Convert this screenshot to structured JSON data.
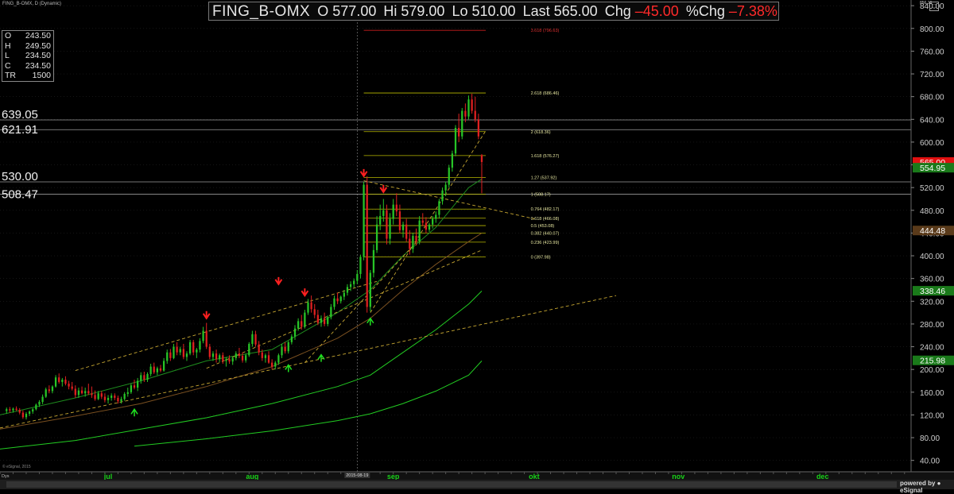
{
  "header": {
    "chart_id": "FING_B-OMX, D (Dynamic)",
    "symbol": "FING_B-OMX",
    "open_label": "O",
    "open": "577.00",
    "high_label": "Hi",
    "high": "579.00",
    "low_label": "Lo",
    "low": "510.00",
    "last_label": "Last",
    "last": "565.00",
    "chg_label": "Chg",
    "chg": "–45.00",
    "pchg_label": "%Chg",
    "pchg": "–7.38%"
  },
  "cursor_box": {
    "rows": [
      {
        "label": "O",
        "value": "243.50"
      },
      {
        "label": "H",
        "value": "249.50"
      },
      {
        "label": "L",
        "value": "234.50"
      },
      {
        "label": "C",
        "value": "234.50"
      },
      {
        "label": "TR",
        "value": "1500"
      }
    ]
  },
  "controls": {
    "corner_button": "□"
  },
  "footer": {
    "copyright": "© eSignal, 2015",
    "powered_by": "powered by ● eSignal",
    "period_label": "Dys"
  },
  "colors": {
    "background": "#000000",
    "up_candle": "#27c427",
    "down_candle": "#e02020",
    "trendline": "#c8a832",
    "fib_line": "#b8b800",
    "fib_top_line": "#c81e1e",
    "hline": "#9a9a9a",
    "ma_fast": "#1e8c1e",
    "ma_mid": "#7a5020",
    "ma_slow": "#22cc22",
    "last_tag": "#e01010",
    "ma_tag": "#1a7a1a"
  },
  "chart_data": {
    "type": "candlestick",
    "ylim": [
      20,
      850
    ],
    "yticks": [
      40,
      80,
      120,
      160,
      200,
      240,
      280,
      320,
      360,
      400,
      440,
      480,
      520,
      560,
      600,
      640,
      680,
      720,
      760,
      800,
      840
    ],
    "yticks_labels": [
      "40.00",
      "80.00",
      "120.00",
      "160.00",
      "200.00",
      "240.00",
      "280.00",
      "320.00",
      "360.00",
      "400.00",
      "440.00",
      "480.00",
      "520.00",
      "560.00",
      "600.00",
      "640.00",
      "680.00",
      "720.00",
      "760.00",
      "800.00",
      "840.00"
    ],
    "top_tick_label": "856.16",
    "x_months": [
      {
        "label": "jul",
        "x": 20
      },
      {
        "label": "aug",
        "x": 64
      },
      {
        "label": "sep",
        "x": 107
      },
      {
        "label": "okt",
        "x": 150
      },
      {
        "label": "nov",
        "x": 194
      },
      {
        "label": "dec",
        "x": 238
      }
    ],
    "x_cursor": {
      "label": "2015-08-19",
      "x": 96
    },
    "xlim": [
      -13,
      265
    ],
    "candles": [
      [
        -11,
        127,
        133,
        122,
        130
      ],
      [
        -10,
        130,
        134,
        124,
        128
      ],
      [
        -9,
        128,
        133,
        124,
        131
      ],
      [
        -8,
        131,
        135,
        127,
        129
      ],
      [
        -7,
        129,
        132,
        121,
        124
      ],
      [
        -6,
        124,
        128,
        113,
        116
      ],
      [
        -5,
        116,
        125,
        112,
        122
      ],
      [
        -4,
        122,
        128,
        118,
        126
      ],
      [
        -3,
        126,
        132,
        122,
        130
      ],
      [
        -2,
        130,
        140,
        128,
        138
      ],
      [
        -1,
        138,
        146,
        134,
        143
      ],
      [
        0,
        143,
        156,
        139,
        152
      ],
      [
        1,
        152,
        168,
        150,
        165
      ],
      [
        2,
        165,
        172,
        158,
        162
      ],
      [
        3,
        162,
        172,
        158,
        170
      ],
      [
        4,
        170,
        190,
        168,
        186
      ],
      [
        5,
        186,
        193,
        175,
        178
      ],
      [
        6,
        178,
        185,
        170,
        182
      ],
      [
        7,
        182,
        188,
        172,
        175
      ],
      [
        8,
        175,
        180,
        165,
        170
      ],
      [
        9,
        170,
        178,
        163,
        166
      ],
      [
        10,
        166,
        172,
        150,
        155
      ],
      [
        11,
        155,
        168,
        150,
        163
      ],
      [
        12,
        163,
        170,
        156,
        158
      ],
      [
        13,
        158,
        168,
        152,
        162
      ],
      [
        14,
        162,
        175,
        155,
        158
      ],
      [
        15,
        158,
        170,
        150,
        155
      ],
      [
        16,
        155,
        163,
        145,
        148
      ],
      [
        17,
        148,
        162,
        146,
        158
      ],
      [
        18,
        158,
        162,
        148,
        152
      ],
      [
        19,
        152,
        158,
        142,
        146
      ],
      [
        20,
        146,
        155,
        140,
        150
      ],
      [
        21,
        150,
        158,
        145,
        154
      ],
      [
        22,
        154,
        158,
        146,
        150
      ],
      [
        23,
        150,
        154,
        140,
        144
      ],
      [
        24,
        144,
        152,
        140,
        148
      ],
      [
        25,
        148,
        160,
        145,
        157
      ],
      [
        26,
        157,
        168,
        152,
        160
      ],
      [
        27,
        160,
        175,
        157,
        172
      ],
      [
        28,
        172,
        182,
        165,
        168
      ],
      [
        29,
        168,
        185,
        162,
        180
      ],
      [
        30,
        180,
        195,
        175,
        190
      ],
      [
        31,
        190,
        196,
        178,
        182
      ],
      [
        32,
        182,
        195,
        178,
        192
      ],
      [
        33,
        192,
        210,
        188,
        205
      ],
      [
        34,
        205,
        212,
        192,
        195
      ],
      [
        35,
        195,
        205,
        190,
        202
      ],
      [
        36,
        202,
        208,
        195,
        198
      ],
      [
        37,
        198,
        220,
        196,
        215
      ],
      [
        38,
        215,
        235,
        210,
        230
      ],
      [
        39,
        230,
        236,
        215,
        220
      ],
      [
        40,
        220,
        245,
        218,
        240
      ],
      [
        41,
        240,
        248,
        225,
        230
      ],
      [
        42,
        230,
        240,
        225,
        236
      ],
      [
        43,
        236,
        245,
        218,
        222
      ],
      [
        44,
        222,
        232,
        215,
        228
      ],
      [
        45,
        228,
        252,
        225,
        248
      ],
      [
        46,
        248,
        252,
        225,
        230
      ],
      [
        47,
        230,
        238,
        220,
        235
      ],
      [
        48,
        235,
        255,
        230,
        250
      ],
      [
        49,
        250,
        275,
        246,
        268
      ],
      [
        50,
        268,
        282,
        236,
        240
      ],
      [
        51,
        240,
        245,
        218,
        222
      ],
      [
        52,
        222,
        232,
        215,
        228
      ],
      [
        53,
        228,
        235,
        212,
        218
      ],
      [
        54,
        218,
        228,
        213,
        225
      ],
      [
        55,
        225,
        230,
        210,
        215
      ],
      [
        56,
        215,
        222,
        205,
        218
      ],
      [
        57,
        218,
        225,
        210,
        214
      ],
      [
        58,
        214,
        222,
        208,
        220
      ],
      [
        59,
        220,
        232,
        216,
        228
      ],
      [
        60,
        228,
        238,
        220,
        224
      ],
      [
        61,
        224,
        230,
        212,
        216
      ],
      [
        62,
        216,
        228,
        212,
        225
      ],
      [
        63,
        225,
        248,
        222,
        245
      ],
      [
        64,
        245,
        268,
        240,
        262
      ],
      [
        65,
        262,
        268,
        240,
        244
      ],
      [
        66,
        244,
        250,
        225,
        230
      ],
      [
        67,
        230,
        235,
        215,
        220
      ],
      [
        68,
        220,
        228,
        212,
        225
      ],
      [
        69,
        225,
        232,
        210,
        212
      ],
      [
        70,
        212,
        218,
        200,
        205
      ],
      [
        71,
        205,
        215,
        200,
        212
      ],
      [
        72,
        212,
        228,
        208,
        225
      ],
      [
        73,
        225,
        245,
        220,
        240
      ],
      [
        74,
        240,
        248,
        228,
        232
      ],
      [
        75,
        232,
        250,
        228,
        248
      ],
      [
        76,
        248,
        262,
        244,
        258
      ],
      [
        77,
        258,
        278,
        252,
        272
      ],
      [
        78,
        272,
        290,
        268,
        285
      ],
      [
        79,
        285,
        296,
        270,
        275
      ],
      [
        80,
        275,
        305,
        272,
        300
      ],
      [
        81,
        300,
        324,
        296,
        318
      ],
      [
        82,
        318,
        330,
        300,
        306
      ],
      [
        83,
        306,
        315,
        290,
        296
      ],
      [
        84,
        296,
        305,
        278,
        282
      ],
      [
        85,
        282,
        295,
        275,
        290
      ],
      [
        86,
        290,
        300,
        276,
        280
      ],
      [
        87,
        280,
        295,
        276,
        292
      ],
      [
        88,
        292,
        315,
        288,
        310
      ],
      [
        89,
        310,
        330,
        305,
        325
      ],
      [
        90,
        325,
        335,
        315,
        320
      ],
      [
        91,
        320,
        330,
        316,
        328
      ],
      [
        92,
        328,
        340,
        322,
        335
      ],
      [
        93,
        335,
        350,
        330,
        345
      ],
      [
        94,
        345,
        355,
        338,
        350
      ],
      [
        95,
        350,
        360,
        344,
        356
      ],
      [
        96,
        356,
        375,
        350,
        368
      ],
      [
        97,
        368,
        402,
        360,
        398
      ],
      [
        98,
        398,
        530,
        392,
        525
      ],
      [
        99,
        525,
        540,
        300,
        310
      ],
      [
        100,
        310,
        375,
        302,
        370
      ],
      [
        101,
        370,
        420,
        362,
        410
      ],
      [
        102,
        410,
        470,
        405,
        455
      ],
      [
        103,
        455,
        490,
        445,
        470
      ],
      [
        104,
        470,
        500,
        460,
        480
      ],
      [
        105,
        480,
        490,
        420,
        430
      ],
      [
        106,
        430,
        475,
        420,
        465
      ],
      [
        107,
        465,
        500,
        455,
        490
      ],
      [
        108,
        490,
        510,
        470,
        478
      ],
      [
        109,
        478,
        490,
        440,
        445
      ],
      [
        110,
        445,
        460,
        432,
        455
      ],
      [
        111,
        455,
        465,
        425,
        430
      ],
      [
        112,
        430,
        445,
        402,
        412
      ],
      [
        113,
        412,
        440,
        405,
        435
      ],
      [
        114,
        435,
        448,
        418,
        425
      ],
      [
        115,
        425,
        470,
        420,
        462
      ],
      [
        116,
        462,
        475,
        452,
        458
      ],
      [
        117,
        458,
        468,
        440,
        446
      ],
      [
        118,
        446,
        458,
        442,
        455
      ],
      [
        119,
        455,
        470,
        448,
        465
      ],
      [
        120,
        465,
        478,
        458,
        472
      ],
      [
        121,
        472,
        500,
        466,
        496
      ],
      [
        122,
        496,
        520,
        490,
        515
      ],
      [
        123,
        515,
        530,
        505,
        525
      ],
      [
        124,
        525,
        560,
        520,
        555
      ],
      [
        125,
        555,
        585,
        548,
        580
      ],
      [
        126,
        580,
        630,
        575,
        625
      ],
      [
        127,
        625,
        650,
        600,
        610
      ],
      [
        128,
        610,
        660,
        605,
        655
      ],
      [
        129,
        655,
        668,
        635,
        645
      ],
      [
        130,
        645,
        682,
        640,
        675
      ],
      [
        131,
        675,
        685,
        650,
        655
      ],
      [
        132,
        655,
        680,
        635,
        640
      ],
      [
        133,
        640,
        650,
        605,
        610
      ],
      [
        134,
        577,
        579,
        510,
        565
      ]
    ],
    "moving_averages": [
      {
        "points": [
          [
            -13,
            120
          ],
          [
            10,
            150
          ],
          [
            30,
            180
          ],
          [
            50,
            215
          ],
          [
            70,
            235
          ],
          [
            90,
            300
          ],
          [
            100,
            340
          ],
          [
            110,
            400
          ],
          [
            120,
            450
          ],
          [
            130,
            520
          ],
          [
            134,
            535
          ]
        ]
      },
      {
        "points": [
          [
            -13,
            95
          ],
          [
            10,
            118
          ],
          [
            30,
            140
          ],
          [
            50,
            170
          ],
          [
            70,
            205
          ],
          [
            90,
            255
          ],
          [
            100,
            290
          ],
          [
            110,
            340
          ],
          [
            120,
            385
          ],
          [
            130,
            425
          ],
          [
            134,
            440
          ]
        ]
      },
      {
        "points": [
          [
            -13,
            60
          ],
          [
            10,
            75
          ],
          [
            30,
            95
          ],
          [
            50,
            115
          ],
          [
            70,
            140
          ],
          [
            90,
            170
          ],
          [
            100,
            190
          ],
          [
            110,
            230
          ],
          [
            120,
            270
          ],
          [
            130,
            315
          ],
          [
            134,
            338
          ]
        ]
      },
      {
        "points": [
          [
            28,
            65
          ],
          [
            50,
            78
          ],
          [
            70,
            92
          ],
          [
            90,
            110
          ],
          [
            100,
            122
          ],
          [
            110,
            140
          ],
          [
            120,
            162
          ],
          [
            130,
            190
          ],
          [
            134,
            215
          ]
        ]
      }
    ],
    "trendlines": [
      {
        "from": [
          -13,
          97
        ],
        "to": [
          175,
          330
        ]
      },
      {
        "from": [
          10,
          198
        ],
        "to": [
          102,
          355
        ]
      },
      {
        "from": [
          50,
          202
        ],
        "to": [
          134,
          410
        ]
      },
      {
        "from": [
          80,
          212
        ],
        "to": [
          115,
          430
        ]
      },
      {
        "from": [
          98,
          532
        ],
        "to": [
          150,
          465
        ]
      },
      {
        "from": [
          100,
          300
        ],
        "to": [
          135,
          618
        ]
      }
    ],
    "horizontal_lines": [
      {
        "value": 639.05,
        "label": "639.05"
      },
      {
        "value": 621.91,
        "label": "621.91"
      },
      {
        "value": 530.0,
        "label": "530.00"
      },
      {
        "value": 508.47,
        "label": "508.47"
      }
    ],
    "fib_levels": [
      {
        "label": "3.618 (796.63)",
        "value": 796.63,
        "top": true
      },
      {
        "label": "2.618 (686.46)",
        "value": 686.46
      },
      {
        "label": "2 (618.36)",
        "value": 618.36
      },
      {
        "label": "1.618 (576.27)",
        "value": 576.27
      },
      {
        "label": "1.27 (537.92)",
        "value": 537.92
      },
      {
        "label": "1 (508.17)",
        "value": 508.17
      },
      {
        "label": "0.764 (482.17)",
        "value": 482.17
      },
      {
        "label": "0.618 (466.08)",
        "value": 466.08
      },
      {
        "label": "0.5 (453.08)",
        "value": 453.08
      },
      {
        "label": "0.382 (440.07)",
        "value": 440.07
      },
      {
        "label": "0.236 (423.99)",
        "value": 423.99
      },
      {
        "label": "0 (397.98)",
        "value": 397.98
      }
    ],
    "fib_x_range": [
      98,
      134
    ],
    "down_arrows": [
      [
        50,
        290
      ],
      [
        98,
        540
      ],
      [
        104,
        512
      ],
      [
        80,
        330
      ],
      [
        72,
        350
      ]
    ],
    "up_arrows": [
      [
        28,
        130
      ],
      [
        75,
        208
      ],
      [
        85,
        226
      ],
      [
        100,
        290
      ]
    ],
    "price_tags": [
      {
        "value": 565.0,
        "label": "565.00",
        "kind": "last"
      },
      {
        "value": 554.95,
        "label": "554.95",
        "kind": "ma"
      },
      {
        "value": 444.48,
        "label": "444.48",
        "kind": "brown"
      },
      {
        "value": 338.46,
        "label": "338.46",
        "kind": "ma"
      },
      {
        "value": 215.98,
        "label": "215.98",
        "kind": "ma"
      }
    ]
  }
}
